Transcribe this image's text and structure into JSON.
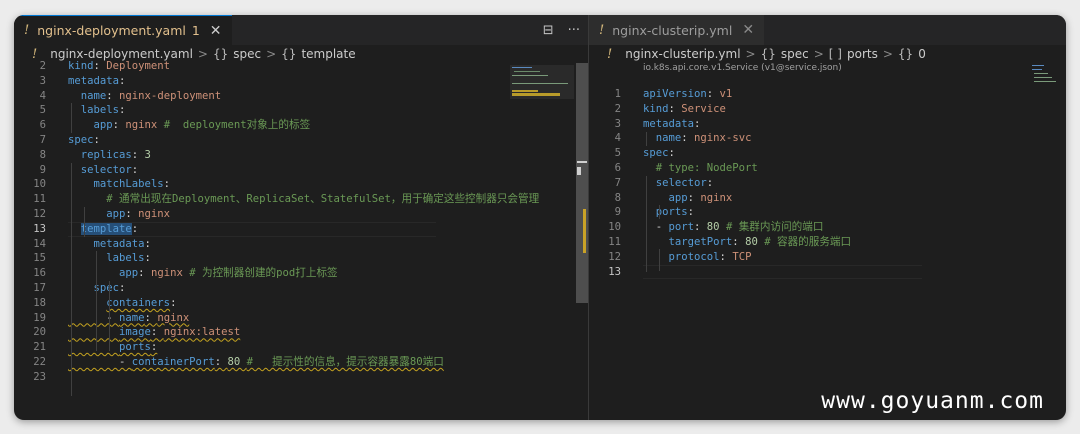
{
  "left": {
    "tab": {
      "bang": "!",
      "name": "nginx-deployment.yaml",
      "count": "1",
      "close": "✕"
    },
    "actions": {
      "split": "⊟",
      "more": "···"
    },
    "breadcrumb": {
      "file": "nginx-deployment.yaml",
      "sep1": ">",
      "sym1": "{}",
      "p1": "spec",
      "sep2": ">",
      "sym2": "{}",
      "p2": "template"
    },
    "lines": [
      {
        "n": "2",
        "t": [
          [
            "kind",
            "k"
          ],
          [
            ": ",
            "p"
          ],
          [
            "Deployment",
            "v"
          ]
        ]
      },
      {
        "n": "3",
        "t": [
          [
            "metadata",
            "k"
          ],
          [
            ":",
            "p"
          ]
        ]
      },
      {
        "n": "4",
        "t": [
          [
            "  name",
            "k"
          ],
          [
            ": ",
            "p"
          ],
          [
            "nginx-deployment",
            "v"
          ]
        ]
      },
      {
        "n": "5",
        "t": [
          [
            "  labels",
            "k"
          ],
          [
            ":",
            "p"
          ]
        ]
      },
      {
        "n": "6",
        "t": [
          [
            "    app",
            "k"
          ],
          [
            ": ",
            "p"
          ],
          [
            "nginx ",
            "v"
          ],
          [
            "#  deployment对象上的标签",
            "c"
          ]
        ]
      },
      {
        "n": "7",
        "t": [
          [
            "spec",
            "k"
          ],
          [
            ":",
            "p"
          ]
        ]
      },
      {
        "n": "8",
        "t": [
          [
            "  replicas",
            "k"
          ],
          [
            ": ",
            "p"
          ],
          [
            "3",
            "n"
          ]
        ]
      },
      {
        "n": "9",
        "t": [
          [
            "  selector",
            "k"
          ],
          [
            ":",
            "p"
          ]
        ]
      },
      {
        "n": "10",
        "t": [
          [
            "    matchLabels",
            "k"
          ],
          [
            ":",
            "p"
          ]
        ]
      },
      {
        "n": "11",
        "t": [
          [
            "      # 通常出现在Deployment、ReplicaSet、StatefulSet，用于确定这些控制器只会管理",
            "c"
          ]
        ]
      },
      {
        "n": "12",
        "t": [
          [
            "      app",
            "k"
          ],
          [
            ": ",
            "p"
          ],
          [
            "nginx",
            "v"
          ]
        ]
      },
      {
        "n": "13",
        "t": [
          [
            "  ",
            "p"
          ],
          [
            "template",
            "k sel"
          ],
          [
            ":",
            "p"
          ]
        ],
        "cur": true
      },
      {
        "n": "14",
        "t": [
          [
            "    metadata",
            "k"
          ],
          [
            ":",
            "p"
          ]
        ]
      },
      {
        "n": "15",
        "t": [
          [
            "      labels",
            "k"
          ],
          [
            ":",
            "p"
          ]
        ]
      },
      {
        "n": "16",
        "t": [
          [
            "        app",
            "k"
          ],
          [
            ": ",
            "p"
          ],
          [
            "nginx ",
            "v"
          ],
          [
            "# 为控制器创建的pod打上标签",
            "c"
          ]
        ]
      },
      {
        "n": "17",
        "t": [
          [
            "    spec",
            "k"
          ],
          [
            ":",
            "p"
          ]
        ]
      },
      {
        "n": "18",
        "t": [
          [
            "      ",
            "p"
          ],
          [
            "containers",
            "k squig"
          ],
          [
            ":",
            "p"
          ]
        ]
      },
      {
        "n": "19",
        "t": [
          [
            "      - ",
            "p squig"
          ],
          [
            "name",
            "k squig"
          ],
          [
            ": ",
            "p squig"
          ],
          [
            "nginx",
            "v squig"
          ]
        ]
      },
      {
        "n": "20",
        "t": [
          [
            "        ",
            "p squig"
          ],
          [
            "image",
            "k squig"
          ],
          [
            ": ",
            "p squig"
          ],
          [
            "nginx:latest",
            "v squig"
          ]
        ]
      },
      {
        "n": "21",
        "t": [
          [
            "        ",
            "p squig"
          ],
          [
            "ports",
            "k squig"
          ],
          [
            ":",
            "p squig"
          ]
        ]
      },
      {
        "n": "22",
        "t": [
          [
            "        - ",
            "p squig"
          ],
          [
            "containerPort",
            "k squig"
          ],
          [
            ": ",
            "p squig"
          ],
          [
            "80 ",
            "n squig"
          ],
          [
            "#   提示性的信息，提示容器暴露80端口",
            "c squig"
          ]
        ]
      },
      {
        "n": "23",
        "t": []
      }
    ]
  },
  "right": {
    "tab": {
      "bang": "!",
      "name": "nginx-clusterip.yml",
      "close": "✕"
    },
    "breadcrumb": {
      "file": "nginx-clusterip.yml",
      "sep1": ">",
      "sym1": "{}",
      "p1": "spec",
      "sep2": ">",
      "sym2": "[ ]",
      "p2": "ports",
      "sep3": ">",
      "sym3": "{}",
      "p3": "0"
    },
    "schema_hint": "io.k8s.api.core.v1.Service (v1@service.json)",
    "lines": [
      {
        "n": "1",
        "t": [
          [
            "apiVersion",
            "k"
          ],
          [
            ": ",
            "p"
          ],
          [
            "v1",
            "v"
          ]
        ]
      },
      {
        "n": "2",
        "t": [
          [
            "kind",
            "k"
          ],
          [
            ": ",
            "p"
          ],
          [
            "Service",
            "v"
          ]
        ]
      },
      {
        "n": "3",
        "t": [
          [
            "metadata",
            "k"
          ],
          [
            ":",
            "p"
          ]
        ]
      },
      {
        "n": "4",
        "t": [
          [
            "  name",
            "k"
          ],
          [
            ": ",
            "p"
          ],
          [
            "nginx-svc",
            "v"
          ]
        ]
      },
      {
        "n": "5",
        "t": [
          [
            "spec",
            "k"
          ],
          [
            ":",
            "p"
          ]
        ]
      },
      {
        "n": "6",
        "t": [
          [
            "  # type: NodePort",
            "c"
          ]
        ]
      },
      {
        "n": "7",
        "t": [
          [
            "  selector",
            "k"
          ],
          [
            ":",
            "p"
          ]
        ]
      },
      {
        "n": "8",
        "t": [
          [
            "    app",
            "k"
          ],
          [
            ": ",
            "p"
          ],
          [
            "nginx",
            "v"
          ]
        ]
      },
      {
        "n": "9",
        "t": [
          [
            "  ports",
            "k"
          ],
          [
            ":",
            "p"
          ]
        ]
      },
      {
        "n": "10",
        "t": [
          [
            "  - ",
            "p"
          ],
          [
            "port",
            "k"
          ],
          [
            ": ",
            "p"
          ],
          [
            "80 ",
            "n"
          ],
          [
            "# 集群内访问的端口",
            "c"
          ]
        ]
      },
      {
        "n": "11",
        "t": [
          [
            "    targetPort",
            "k"
          ],
          [
            ": ",
            "p"
          ],
          [
            "80 ",
            "n"
          ],
          [
            "# 容器的服务端口",
            "c"
          ]
        ]
      },
      {
        "n": "12",
        "t": [
          [
            "    protocol",
            "k"
          ],
          [
            ": ",
            "p"
          ],
          [
            "TCP",
            "v"
          ]
        ]
      },
      {
        "n": "13",
        "t": [],
        "cur": true
      }
    ]
  },
  "watermark": "www.goyuanm.com"
}
